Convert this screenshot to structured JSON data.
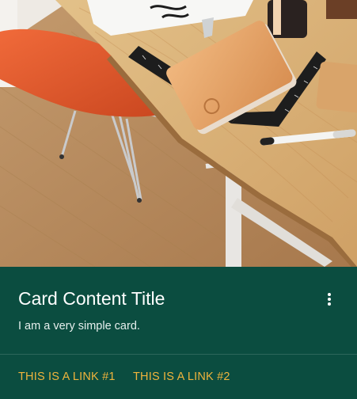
{
  "card": {
    "image_description_icon": "desk-photo",
    "title": "Card Content Title",
    "text": "I am a very simple card.",
    "more_icon": "more-vert-icon",
    "links": [
      {
        "label": "THIS IS A LINK #1"
      },
      {
        "label": "THIS IS A LINK #2"
      }
    ]
  },
  "colors": {
    "card_background": "#0b4d40",
    "link": "#f0b43c",
    "title": "#ffffff"
  }
}
